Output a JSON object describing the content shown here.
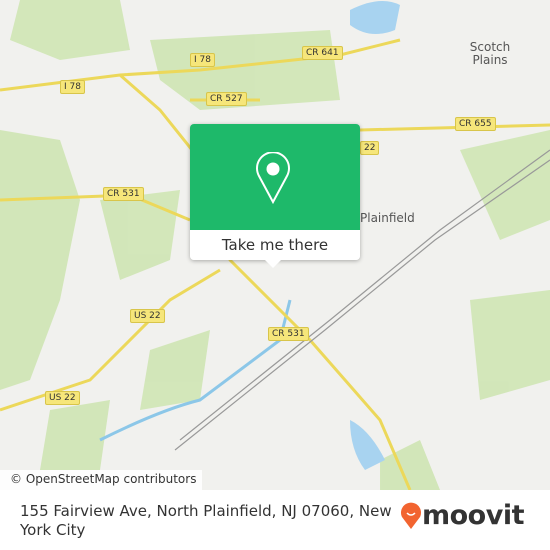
{
  "map": {
    "road_labels": [
      "I 78",
      "CR 641",
      "I 78",
      "CR 527",
      "CR 655",
      "CR 531",
      "US 22",
      "CR 531",
      "US 22",
      "22"
    ],
    "place_labels": [
      "Scotch Plains",
      "Plainfield"
    ],
    "attribution": "© OpenStreetMap contributors",
    "colors": {
      "land": "#f1f1ee",
      "park": "#cfe5b4",
      "water": "#a8d3f0",
      "road": "#f6e67a"
    }
  },
  "popup": {
    "icon": "map-pin-icon",
    "button_label": "Take me there",
    "color": "#1eb96a"
  },
  "footer": {
    "address": "155 Fairview Ave, North Plainfield, NJ 07060, New York City",
    "logo_text": "moovit",
    "logo_color": "#f26430"
  }
}
